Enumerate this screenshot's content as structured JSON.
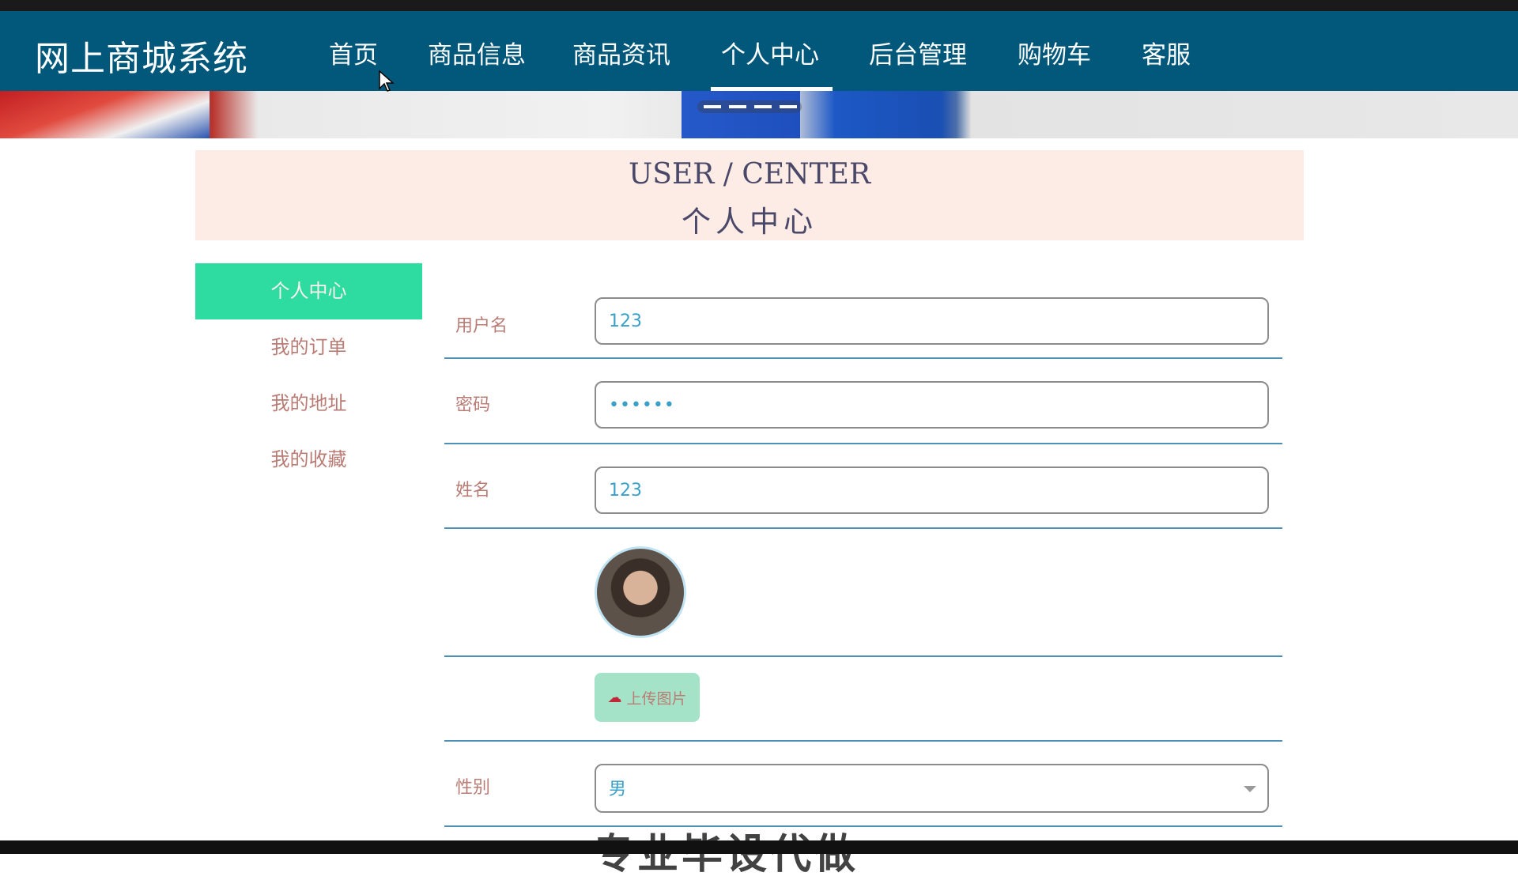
{
  "app": {
    "brand": "网上商城系统"
  },
  "nav": {
    "items": [
      "首页",
      "商品信息",
      "商品资讯",
      "个人中心",
      "后台管理",
      "购物车",
      "客服"
    ],
    "active_index": 3
  },
  "header": {
    "title_en": "USER / CENTER",
    "title_cn": "个人中心"
  },
  "sidebar": {
    "items": [
      "个人中心",
      "我的订单",
      "我的地址",
      "我的收藏"
    ],
    "active_index": 0
  },
  "form": {
    "username": {
      "label": "用户名",
      "value": "123"
    },
    "password": {
      "label": "密码",
      "value": "••••••"
    },
    "name": {
      "label": "姓名",
      "value": "123"
    },
    "upload": {
      "label": "上传图片",
      "icon": "cloud-upload-icon"
    },
    "gender": {
      "label": "性别",
      "value": "男"
    }
  },
  "overlay": {
    "watermark": "专业毕设代做"
  },
  "colors": {
    "navbar": "#01587a",
    "sidebar_active": "#2edba0",
    "title_bg": "#fdece6",
    "label_text": "#b97c75",
    "input_text": "#3aa0c8",
    "upload_btn": "#a5e3c8"
  }
}
